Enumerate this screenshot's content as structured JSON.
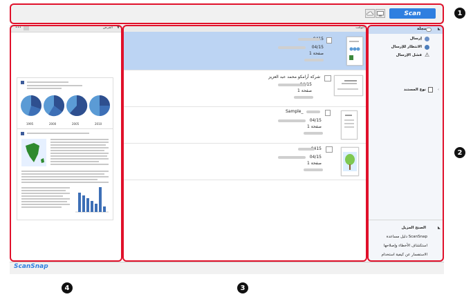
{
  "toolbar": {
    "scan_label": "Scan"
  },
  "callouts": {
    "c1": "1",
    "c2": "2",
    "c3": "3",
    "c4": "4"
  },
  "preview": {
    "header_label": "الفرض"
  },
  "list": {
    "header_label": "الوقت",
    "rows": [
      {
        "name": "0415",
        "date": "04/15",
        "pages": "1 صفحة"
      },
      {
        "name": "شركة أرامكو محمد عبد العزيز",
        "date": "04/15",
        "pages": "1 صفحة"
      },
      {
        "name": "Sample_",
        "date": "04/15",
        "pages": "1 صفحة"
      },
      {
        "name": "0415",
        "date": "04/15",
        "pages": "1 صفحة"
      }
    ]
  },
  "nav": {
    "recent_label": "سجلّة",
    "send_label": "إرسال",
    "wait_label": "الانتظار للإرسال",
    "fail_label": "فشل الإرسال",
    "doctype_label": "نوع المستند",
    "help_header": "الصنح المزيل",
    "help_items": [
      "دليل مساعدة ScanSnap",
      "استكشاف الأخطاء وإصلاحها",
      "الاستفسار عن كيفية استخدام"
    ]
  },
  "pie_years": [
    "1995",
    "2000",
    "2005",
    "2010"
  ],
  "footer": {
    "logo": "ScanSnap"
  },
  "colors": {
    "accent": "#2f7fe0",
    "callout": "#e0102a",
    "selected_row": "#bcd4f3"
  }
}
